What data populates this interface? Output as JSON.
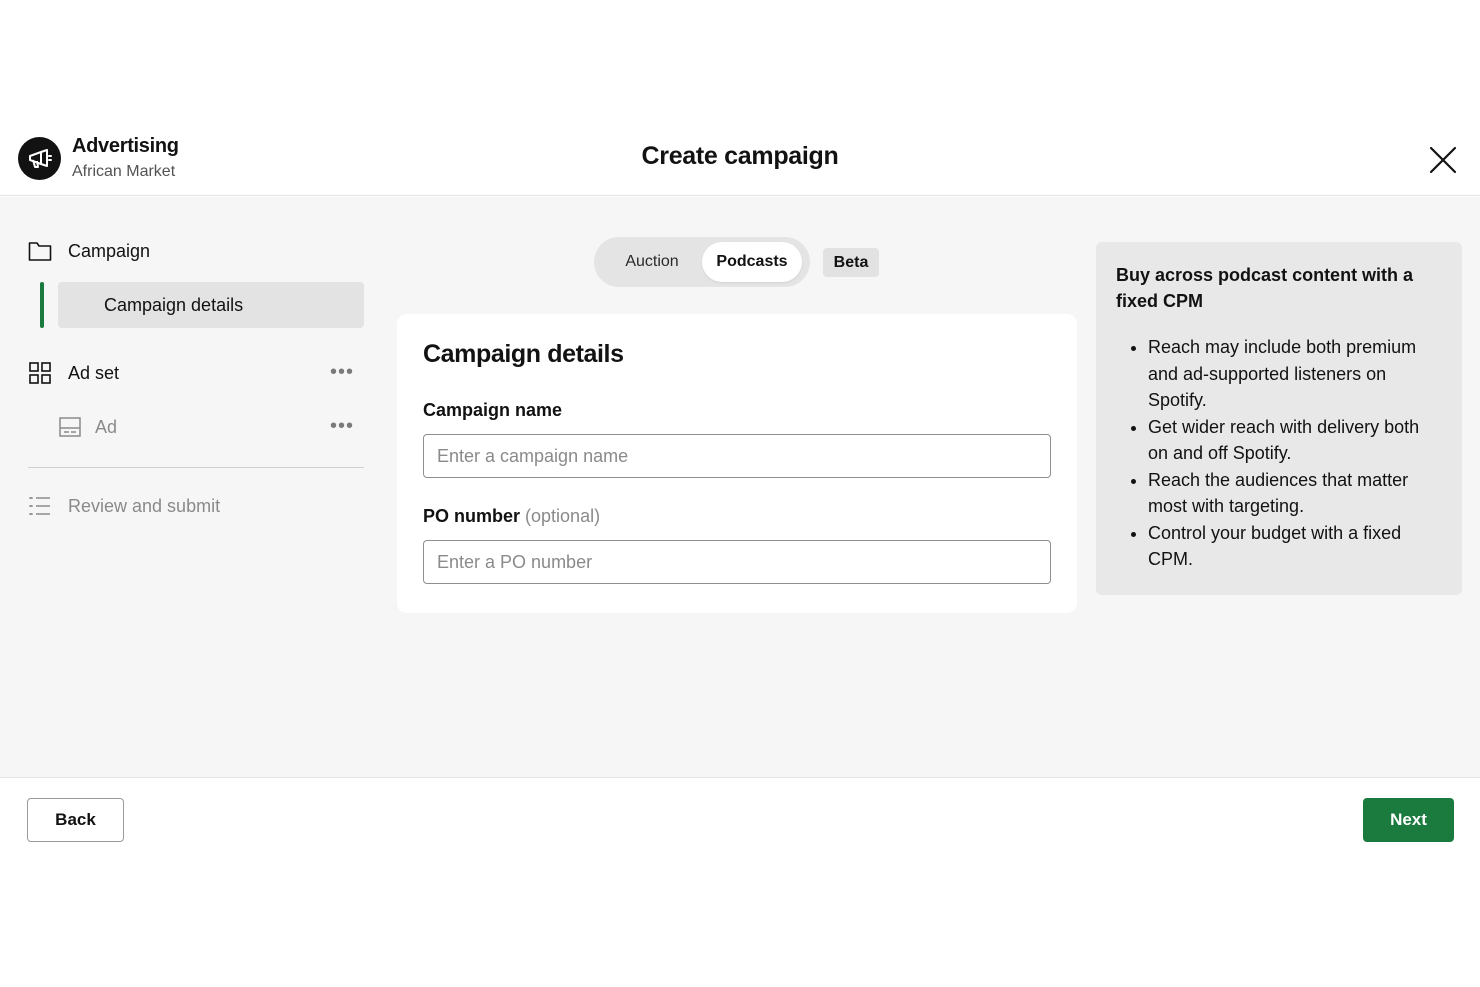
{
  "header": {
    "brand_title": "Advertising",
    "brand_subtitle": "African Market",
    "page_title": "Create campaign",
    "logo_icon": "megaphone-icon",
    "close_icon": "close-icon"
  },
  "sidebar": {
    "items": [
      {
        "label": "Campaign",
        "icon": "folder-icon"
      },
      {
        "label": "Campaign details",
        "active": true
      },
      {
        "label": "Ad set",
        "icon": "grid-icon"
      },
      {
        "label": "Ad",
        "icon": "ad-icon"
      },
      {
        "label": "Review and submit",
        "icon": "list-icon"
      }
    ],
    "more_glyph": "•••"
  },
  "toggle": {
    "options": [
      "Auction",
      "Podcasts"
    ],
    "selected": "Podcasts",
    "badge": "Beta"
  },
  "form": {
    "title": "Campaign details",
    "campaign_name_label": "Campaign name",
    "campaign_name_placeholder": "Enter a campaign name",
    "campaign_name_value": "",
    "po_label": "PO number",
    "po_optional": "(optional)",
    "po_placeholder": "Enter a PO number",
    "po_value": ""
  },
  "info": {
    "title": "Buy across podcast content with a fixed CPM",
    "bullets": [
      "Reach may include both premium and ad-supported listeners on Spotify.",
      "Get wider reach with delivery both on and off Spotify.",
      "Reach the audiences that matter most with targeting.",
      "Control your budget with a fixed CPM."
    ]
  },
  "footer": {
    "back_label": "Back",
    "next_label": "Next"
  },
  "colors": {
    "accent": "#1b7a3e",
    "background": "#f6f6f6",
    "panel": "#e8e8e8"
  }
}
